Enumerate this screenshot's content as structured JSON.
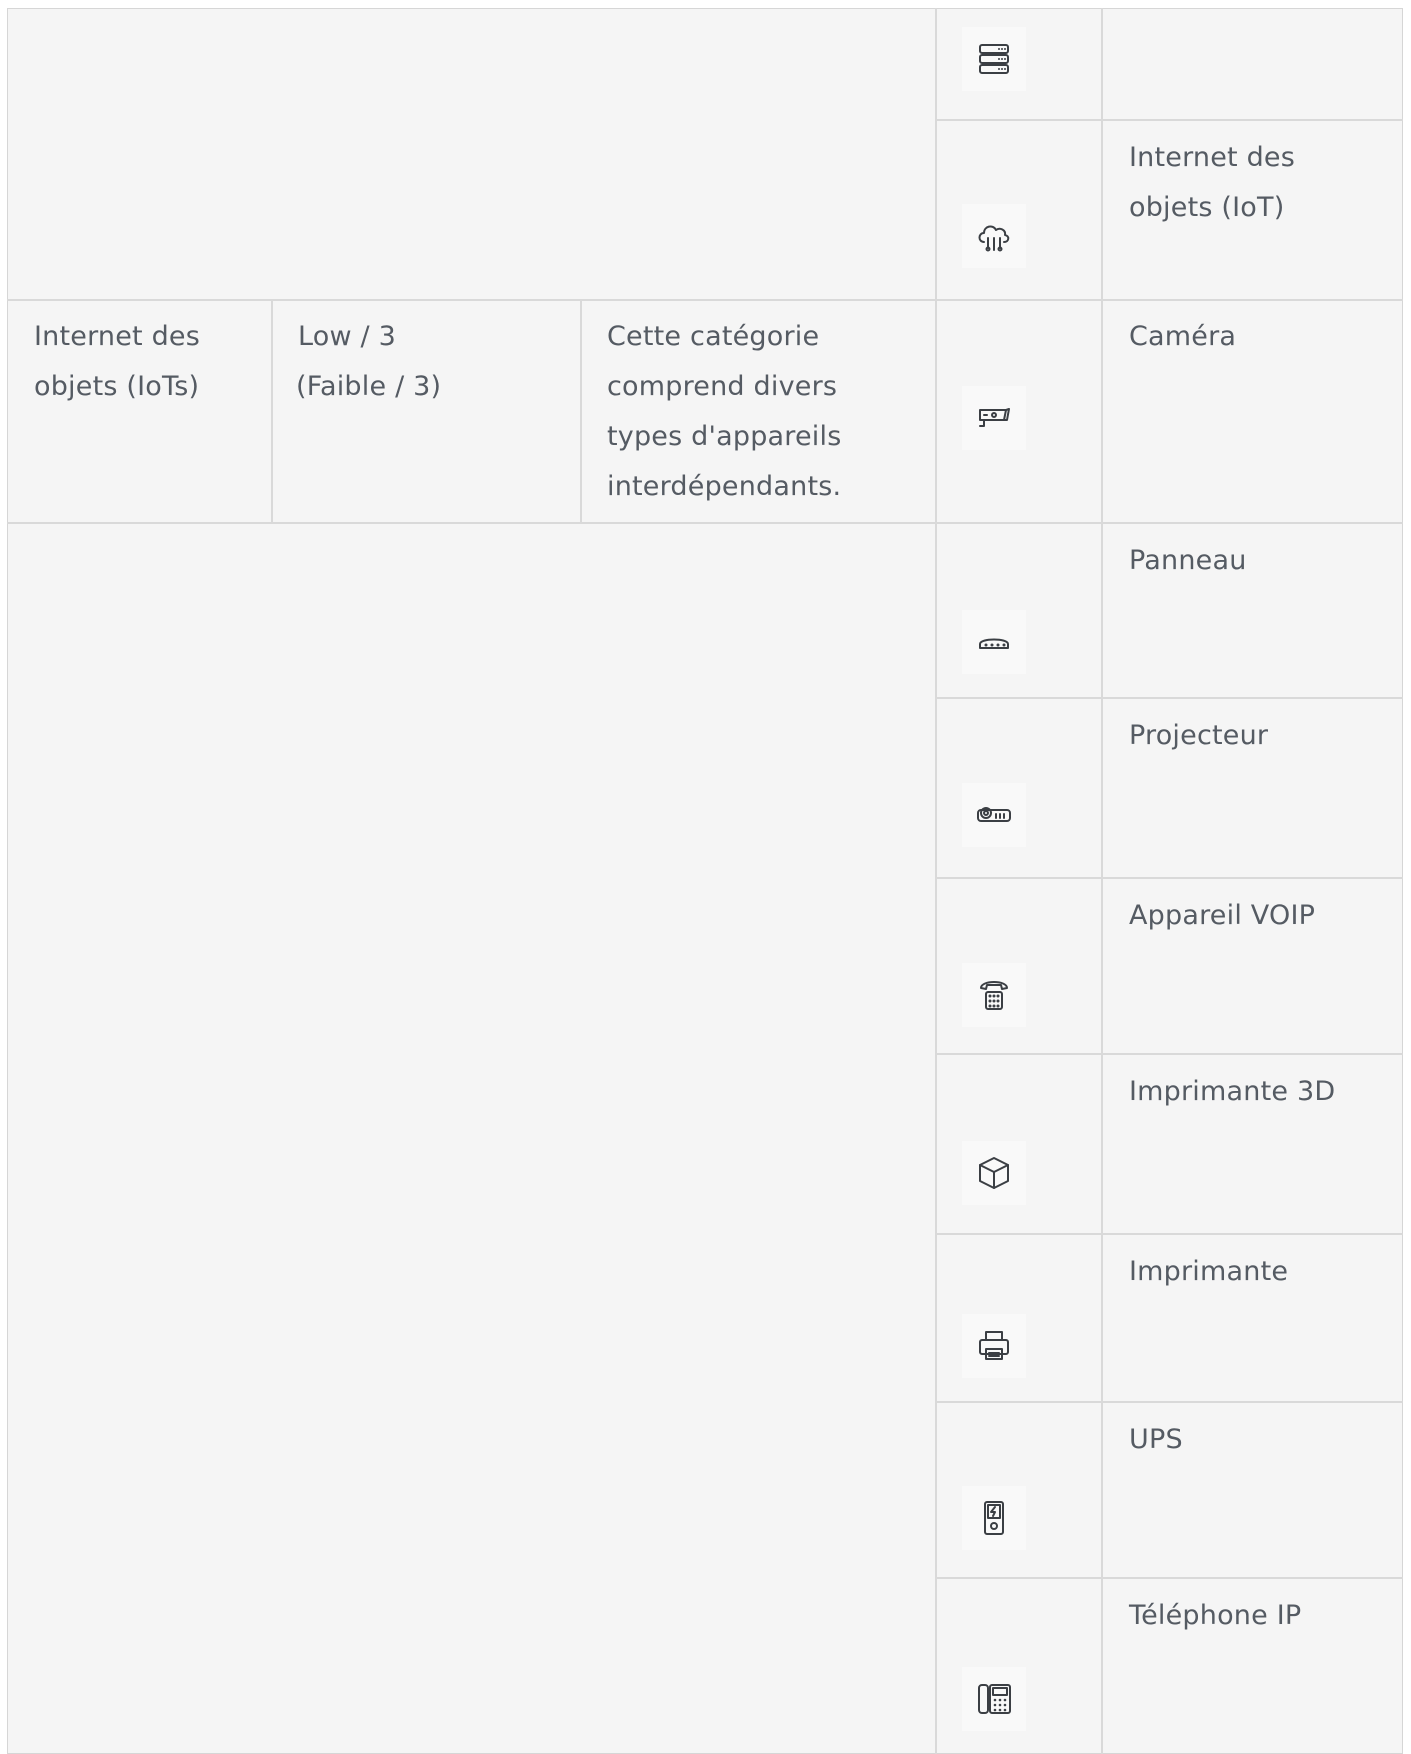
{
  "category_row": {
    "category": "Internet des objets (IoTs)",
    "category_lines": [
      "Internet des",
      "objets (IoTs)"
    ],
    "priority_lines": [
      "Low / 3",
      "(Faible / 3)"
    ],
    "description_lines": [
      "Cette catégorie",
      "comprend divers",
      "types d'appareils",
      "interdépendants."
    ]
  },
  "devices": [
    {
      "icon": "server-rack-icon",
      "label": "",
      "label_lines": []
    },
    {
      "icon": "cloud-iot-icon",
      "label": "Internet des objets (IoT)",
      "label_lines": [
        "Internet des",
        "objets (IoT)"
      ]
    },
    {
      "icon": "camera-icon",
      "label": "Caméra",
      "label_lines": [
        "Caméra"
      ]
    },
    {
      "icon": "panel-icon",
      "label": "Panneau",
      "label_lines": [
        "Panneau"
      ]
    },
    {
      "icon": "projector-icon",
      "label": "Projecteur",
      "label_lines": [
        "Projecteur"
      ]
    },
    {
      "icon": "voip-phone-icon",
      "label": "Appareil VOIP",
      "label_lines": [
        "Appareil VOIP"
      ]
    },
    {
      "icon": "cube-3d-printer-icon",
      "label": "Imprimante 3D",
      "label_lines": [
        "Imprimante 3D"
      ]
    },
    {
      "icon": "printer-icon",
      "label": "Imprimante",
      "label_lines": [
        "Imprimante"
      ]
    },
    {
      "icon": "ups-battery-icon",
      "label": "UPS",
      "label_lines": [
        "UPS"
      ]
    },
    {
      "icon": "ip-phone-icon",
      "label": "Téléphone IP",
      "label_lines": [
        "Téléphone IP"
      ]
    }
  ]
}
